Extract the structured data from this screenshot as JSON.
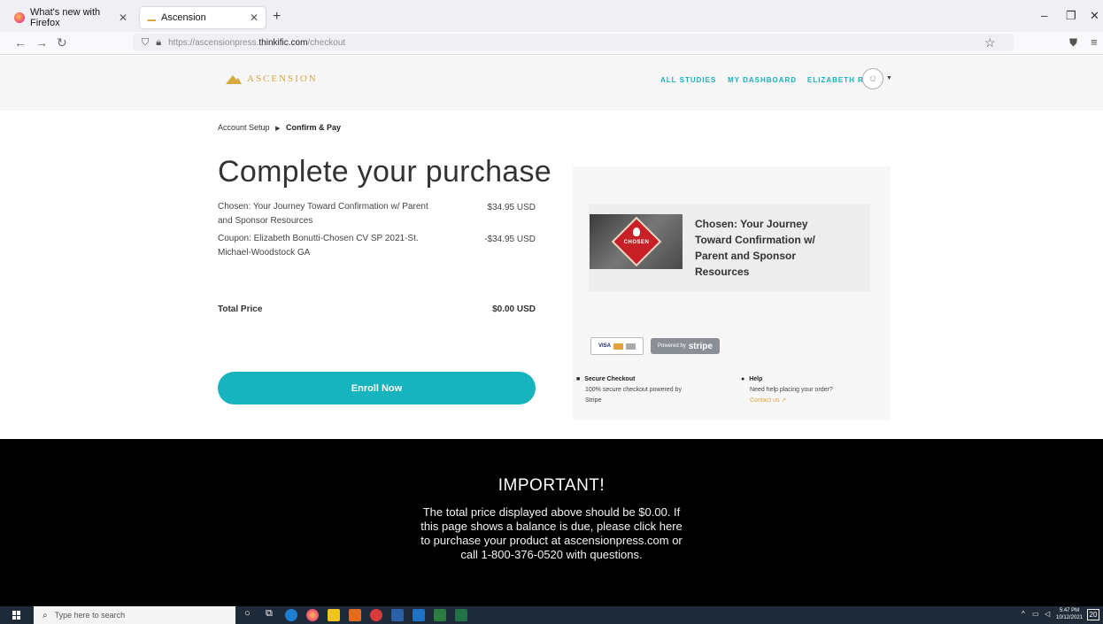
{
  "browser": {
    "tabs": [
      {
        "label": "What's new with Firefox",
        "icon": "firefox-icon"
      },
      {
        "label": "Ascension",
        "icon": "ascension-favicon",
        "active": true
      }
    ],
    "url_prefix": "https://ascensionpress.",
    "url_domain": "thinkific.com",
    "url_path": "/checkout"
  },
  "site": {
    "logo_text": "ASCENSION",
    "nav": {
      "all_studies": "ALL STUDIES",
      "my_dashboard": "MY DASHBOARD",
      "user": "ELIZABETH R"
    },
    "brand_color": "#17b3bf",
    "accent_color": "#d8a940"
  },
  "checkout": {
    "breadcrumb": {
      "step1": "Account Setup",
      "step2": "Confirm & Pay"
    },
    "title": "Complete your purchase",
    "items": [
      {
        "description": "Chosen: Your Journey Toward Confirmation w/ Parent and Sponsor Resources",
        "price": "$34.95 USD"
      },
      {
        "description": "Coupon: Elizabeth Bonutti-Chosen CV SP 2021-St. Michael-Woodstock GA",
        "price": "-$34.95 USD"
      }
    ],
    "total_label": "Total Price",
    "total_price": "$0.00 USD",
    "enroll_label": "Enroll Now"
  },
  "summary_card": {
    "product_thumb_label": "CHOSEN",
    "product_title": "Chosen: Your Journey Toward Confirmation w/ Parent and Sponsor Resources",
    "visa_label": "VISA",
    "stripe_prefix": "Powered by",
    "stripe_brand": "stripe",
    "secure_title": "Secure Checkout",
    "secure_body": "100% secure checkout powered by Stripe",
    "help_title": "Help",
    "help_body": "Need help placing your order?",
    "help_link": "Contact us"
  },
  "banner": {
    "title": "IMPORTANT!",
    "body": "The total price displayed above should be $0.00. If this page shows a balance is due, please click here to purchase your product at ascensionpress.com or call 1-800-376-0520 with questions."
  },
  "taskbar": {
    "search_placeholder": "Type here to search",
    "time": "5:47 PM",
    "date": "10/12/2021",
    "notifications": "20"
  }
}
